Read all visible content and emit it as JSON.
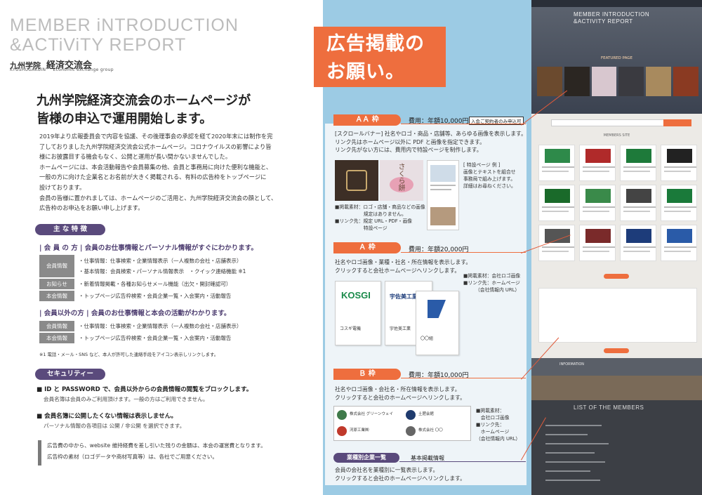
{
  "left": {
    "brand_line1": "MEMBER iNTRODUCTION",
    "brand_line2": "&ACTiViTY REPORT",
    "school_ja": "九州学院",
    "club_ja": "経済交流会",
    "school_en": "KYUSHUGAKUIN",
    "club_en": "Economic exchange group",
    "headline_1": "九州学院経済交流会のホームページが",
    "headline_2": "皆様の申込で運用開始します。",
    "intro": [
      "2019年より広報委員会で内容を協議、その後理事会の承認を経て2020年末には制作を完",
      "了しておりました九州学院経済交流会公式ホームページ。コロナウイルスの影響により皆",
      "様にお披露目する機会もなく、公開と運用が長い間かないませんでした。",
      "ホームページには、本会活動報告や会員募集の他、会員と事務局に向けた便利な機能と、",
      "一般の方に向けた企業名とお名前が大きく掲載される、有料の広告枠をトップページに",
      "設けております。",
      "会員の皆様に置かれましては、ホームページのご活用と、九州学院経済交流会の顔として、",
      "広告枠のお申込をお願い申し上げます。"
    ],
    "features_label": "主 な 特 徴",
    "members_head": "| 会 員 の 方 |  会員のお仕事情報とパーソナル情報がすぐにわかります。",
    "members_rows": [
      {
        "label": "会員情報",
        "lines": [
          "・仕事情報：仕事検索・企業情報表示（一人複数の会社・店舗表示）",
          "・基本情報：会員検索・パーソナル情報表示　・クイック連絡機能 ※1"
        ]
      },
      {
        "label": "お知らせ",
        "lines": [
          "・新着情報掲載・各種お知らせメール機能（出欠・開封確認可）"
        ]
      },
      {
        "label": "本会情報",
        "lines": [
          "・トップページ広告枠検索・会員企業一覧・入会案内・活動報告"
        ]
      }
    ],
    "others_head": "| 会員以外の方 |  会員のお仕事情報と本会の活動がわかります。",
    "others_rows": [
      {
        "label": "会員情報",
        "lines": [
          "・仕事情報：仕事検索・企業情報表示（一人複数の会社・店舗表示）"
        ]
      },
      {
        "label": "本会情報",
        "lines": [
          "・トップページ広告枠検索・会員企業一覧・入会案内・活動報告"
        ]
      }
    ],
    "note": "※1 電話・メール・SNS など、本人が許可した連絡手段をアイコン表示しリンクします。",
    "security_label": "セキュリティー",
    "sec1_title": "■ ID と PASSWORD で、会員以外からの会員情報の閲覧をブロックします。",
    "sec1_desc": "会員名簿は会員のみご利用頂けます。一般の方はご利用できません。",
    "sec2_title": "■ 会員名簿に公開したくない情報は表示しません。",
    "sec2_desc": "パーソナル情報の各項目は 公開 / 非公開 を選択できます。",
    "footer_1": "広告費の中から、website 維持経費を差し引いた残りの金額は、本会の運営費となります。",
    "footer_2": "広告枠の素材（ロゴデータや商材写真等）は、各社でご用意ください。"
  },
  "middle": {
    "title_1": "広告掲載の",
    "title_2": "お願い。",
    "aa": {
      "label": "ＡＡ 枠",
      "price": "費用：年額10,000円",
      "badge": "入会ご契約者のみ申込可",
      "desc": [
        "[スクロールバナー] 社名やロゴ・商品・店舗等、あらゆる画像を表示します。",
        "リンク先はホームページ以外に PDF と画像を指定できます。",
        "リンク先がない方には、費用内で特設ページを制作します。"
      ],
      "special": [
        "[ 特設ページ 例 ]",
        "画像とテキストを組合せ",
        "事務局で組み上げます。",
        "詳細はお尋ねください。"
      ],
      "material": [
        "■掲載素材：ロゴ・店舗・商品などの画像",
        "　　　　　　規定はありません。",
        "■リンク先：規定 URL・PDF・画像",
        "　　　　　　特設ページ"
      ],
      "photo_text": "さくら餅"
    },
    "a": {
      "label": "Ａ 枠",
      "price": "費用：年額20,000円",
      "desc": [
        "社名やロゴ画像・業種・社名・所在情報を表示します。",
        "クリックすると会社ホームページへリンクします。"
      ],
      "material": [
        "■掲載素材：会社ロゴ画像",
        "■リンク先：ホームページ",
        "　　　（会社情報内 URL）"
      ],
      "cards": [
        "コスギ電機",
        "宇佐美工業",
        "〇〇組"
      ],
      "logo1": "KOSGI",
      "logo2": "宇佐美工業"
    },
    "b": {
      "label": "Ｂ 枠",
      "price": "費用：年額10,000円",
      "desc": [
        "社名やロゴ画像・会社名・所在情報を表示します。",
        "クリックすると会社のホームページへリンクします。"
      ],
      "material": [
        "■掲載素材：",
        "　会社ロゴ画像",
        "■リンク先：",
        "　ホームページ",
        "（会社情報内 URL）"
      ],
      "list": [
        "株式会社 グリーンウェイ",
        "土肥会館",
        "河原工業㈱",
        "株式会社 〇〇"
      ]
    },
    "cat": {
      "label": "業種別企業一覧",
      "tag": "基本掲載情報",
      "desc": [
        "会員の会社名を業種別に一覧表示します。",
        "クリックすると会社のホームページへリンクします。"
      ]
    }
  },
  "site": {
    "title_1": "MEMBER INTRODUCTION",
    "title_2": "&ACTIVITY REPORT",
    "featured": "FEATURED PAGE",
    "members_site": "MEMBERS SITE",
    "list_title": "LIST OF THE MEMBERS",
    "info": "INFORMATION"
  },
  "colors": {
    "accent": "#ee6e3e",
    "purple": "#5a4a7c",
    "sky": "#9ccbe4"
  }
}
